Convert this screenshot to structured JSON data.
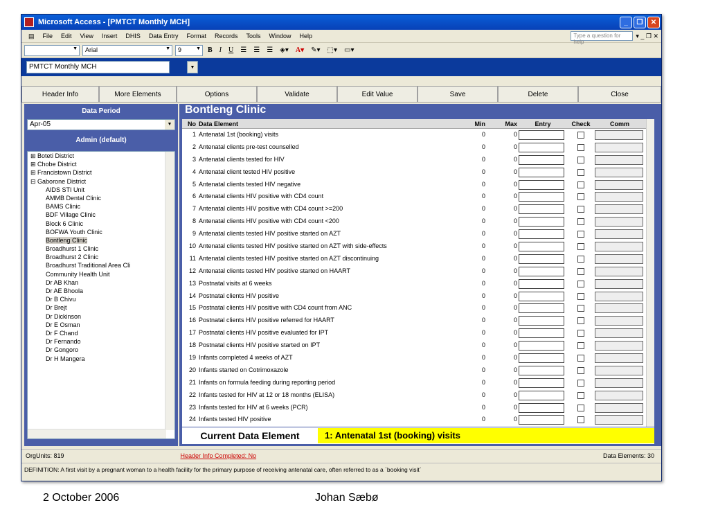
{
  "window": {
    "title": "Microsoft Access - [PMTCT Monthly MCH]"
  },
  "menu": [
    "File",
    "Edit",
    "View",
    "Insert",
    "DHIS",
    "Data Entry",
    "Format",
    "Records",
    "Tools",
    "Window",
    "Help"
  ],
  "help_placeholder": "Type a question for help",
  "toolbar": {
    "font": "Arial",
    "size": "9",
    "bold": "B",
    "italic": "I",
    "underline": "U"
  },
  "form_combo": "PMTCT Monthly MCH",
  "buttons": [
    "Header Info",
    "More Elements",
    "Options",
    "Validate",
    "Edit Value",
    "Save",
    "Delete",
    "Close"
  ],
  "left": {
    "data_period_label": "Data Period",
    "period": "Apr-05",
    "admin_label": "Admin (default)",
    "tree": [
      "Boteti District",
      "Chobe District",
      "Francistown District",
      "Gaborone District",
      "AIDS STI Unit",
      "AMMB Dental Clinic",
      "BAMS Clinic",
      "BDF Village Clinic",
      "Block 6 Clinic",
      "BOFWA Youth Clinic",
      "Bontleng Clinic",
      "Broadhurst 1 Clinic",
      "Broadhurst 2 Clinic",
      "Broadhurst Traditional Area Cli",
      "Community Health Unit",
      "Dr AB Khan",
      "Dr AE Bhoola",
      "Dr B Chivu",
      "Dr Brejt",
      "Dr Dickinson",
      "Dr E Osman",
      "Dr F Chand",
      "Dr Fernando",
      "Dr Gongoro",
      "Dr H Mangera"
    ]
  },
  "main": {
    "clinic": "Bontleng Clinic",
    "headers": {
      "no": "No",
      "de": "Data Element",
      "min": "Min",
      "max": "Max",
      "entry": "Entry",
      "check": "Check",
      "comm": "Comm"
    },
    "rows": [
      {
        "no": "1",
        "de": "Antenatal 1st (booking) visits",
        "min": "0",
        "max": "0"
      },
      {
        "no": "2",
        "de": "Antenatal clients pre-test counselled",
        "min": "0",
        "max": "0"
      },
      {
        "no": "3",
        "de": "Antenatal clients tested for HIV",
        "min": "0",
        "max": "0"
      },
      {
        "no": "4",
        "de": "Antenatal client tested HIV positive",
        "min": "0",
        "max": "0"
      },
      {
        "no": "5",
        "de": "Antenatal clients tested HIV negative",
        "min": "0",
        "max": "0"
      },
      {
        "no": "6",
        "de": "Antenatal clients HIV positive with CD4 count",
        "min": "0",
        "max": "0"
      },
      {
        "no": "7",
        "de": "Antenatal clients HIV positive with CD4 count >=200",
        "min": "0",
        "max": "0"
      },
      {
        "no": "8",
        "de": "Antenatal clients HIV positive with CD4 count <200",
        "min": "0",
        "max": "0"
      },
      {
        "no": "9",
        "de": "Antenatal clients tested HIV positive started on AZT",
        "min": "0",
        "max": "0"
      },
      {
        "no": "10",
        "de": "Antenatal clients tested HIV positive started on AZT with side-effects",
        "min": "0",
        "max": "0"
      },
      {
        "no": "11",
        "de": "Antenatal clients tested HIV positive started on AZT discontinuing",
        "min": "0",
        "max": "0"
      },
      {
        "no": "12",
        "de": "Antenatal clients tested HIV positive started on HAART",
        "min": "0",
        "max": "0"
      },
      {
        "no": "13",
        "de": "Postnatal visits at 6 weeks",
        "min": "0",
        "max": "0"
      },
      {
        "no": "14",
        "de": "Postnatal clients HIV positive",
        "min": "0",
        "max": "0"
      },
      {
        "no": "15",
        "de": "Postnatal clients HIV positive with CD4 count from ANC",
        "min": "0",
        "max": "0"
      },
      {
        "no": "16",
        "de": "Postnatal clients HIV positive referred for HAART",
        "min": "0",
        "max": "0"
      },
      {
        "no": "17",
        "de": "Postnatal clients HIV positive evaluated for IPT",
        "min": "0",
        "max": "0"
      },
      {
        "no": "18",
        "de": "Postnatal clients HIV positive started on IPT",
        "min": "0",
        "max": "0"
      },
      {
        "no": "19",
        "de": "Infants completed 4 weeks of AZT",
        "min": "0",
        "max": "0"
      },
      {
        "no": "20",
        "de": "Infants started on Cotrimoxazole",
        "min": "0",
        "max": "0"
      },
      {
        "no": "21",
        "de": "Infants on formula feeding during reporting period",
        "min": "0",
        "max": "0"
      },
      {
        "no": "22",
        "de": "Infants tested for HIV at 12 or 18 months (ELISA)",
        "min": "0",
        "max": "0"
      },
      {
        "no": "23",
        "de": "Infants tested for HIV at 6 weeks (PCR)",
        "min": "0",
        "max": "0"
      },
      {
        "no": "24",
        "de": "Infants tested HIV positive",
        "min": "0",
        "max": "0"
      }
    ],
    "current_label": "Current Data Element",
    "current_value": "1:  Antenatal 1st (booking) visits"
  },
  "status": {
    "orgunits": "OrgUnits: 819",
    "header": "Header Info Completed: No",
    "elements": "Data Elements: 30"
  },
  "definition": "DEFINITION: A first visit by a pregnant woman to a health facility for the primary purpose of receiving antenatal care, often referred to as a `booking visit`",
  "footer": {
    "date": "2 October 2006",
    "author": "Johan Sæbø"
  }
}
